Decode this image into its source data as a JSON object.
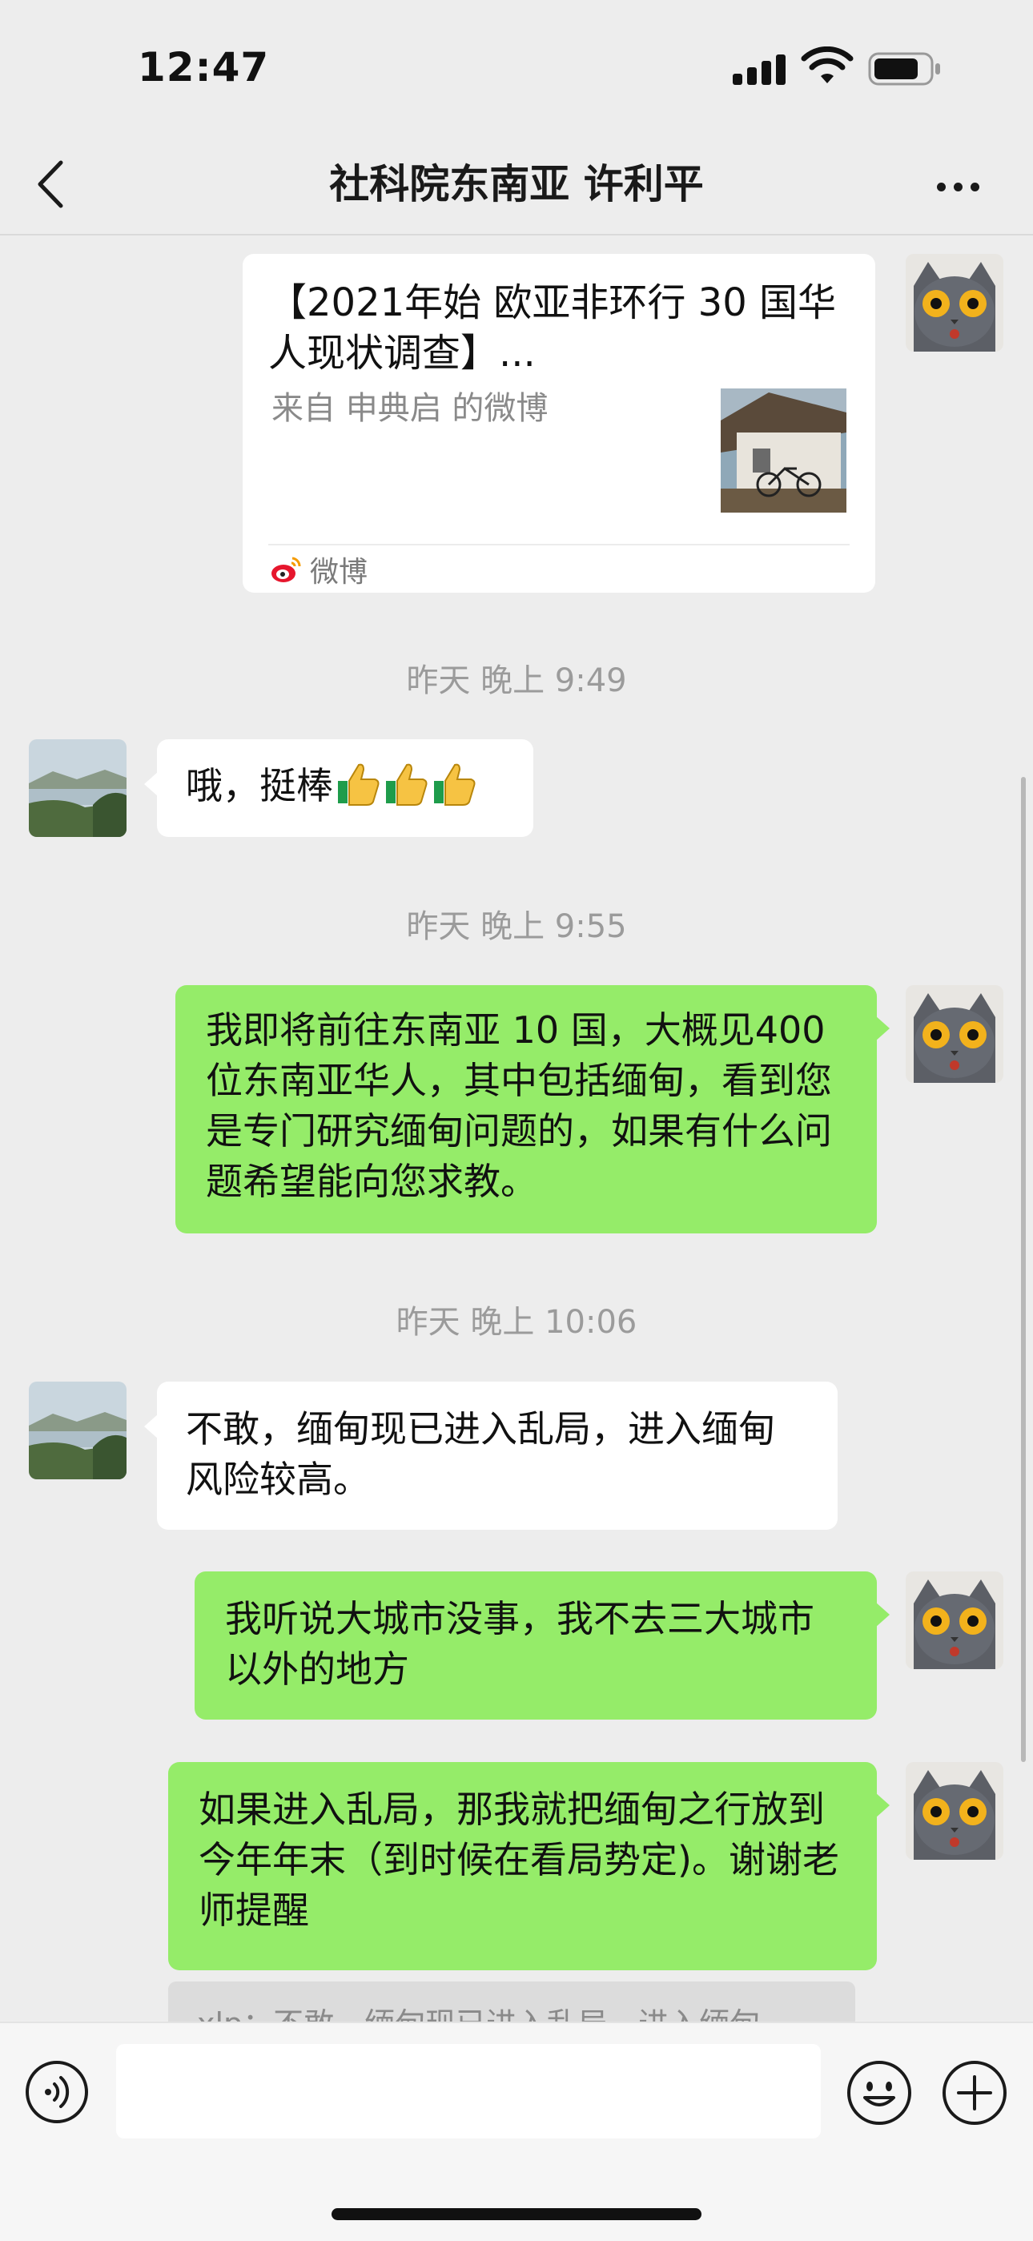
{
  "status_bar": {
    "time": "12:47"
  },
  "nav": {
    "title": "社科院东南亚 许利平"
  },
  "card": {
    "title": "【2021年始 欧亚非环行 30 国华人现状调查】...",
    "source": "来自 申典启 的微博",
    "app_label": "微博"
  },
  "messages": {
    "ts1": "昨天 晚上 9:49",
    "m1": "哦，挺棒",
    "ts2": "昨天 晚上 9:55",
    "m2": "我即将前往东南亚 10 国，大概见400 位东南亚华人，其中包括缅甸，看到您是专门研究缅甸问题的，如果有什么问题希望能向您求教。",
    "ts3": "昨天 晚上 10:06",
    "m3": "不敢，缅甸现已进入乱局，进入缅甸风险较高。",
    "m4": "我听说大城市没事，我不去三大城市以外的地方",
    "m5": "如果进入乱局，那我就把缅甸之行放到今年年末（到时候在看局势定)。谢谢老师提醒",
    "quote": "xlp：不敢，缅甸现已进入乱局，进入缅甸"
  },
  "input": {
    "placeholder": ""
  },
  "colors": {
    "self_bubble": "#95ec69",
    "other_bubble": "#ffffff",
    "background": "#ededed"
  }
}
